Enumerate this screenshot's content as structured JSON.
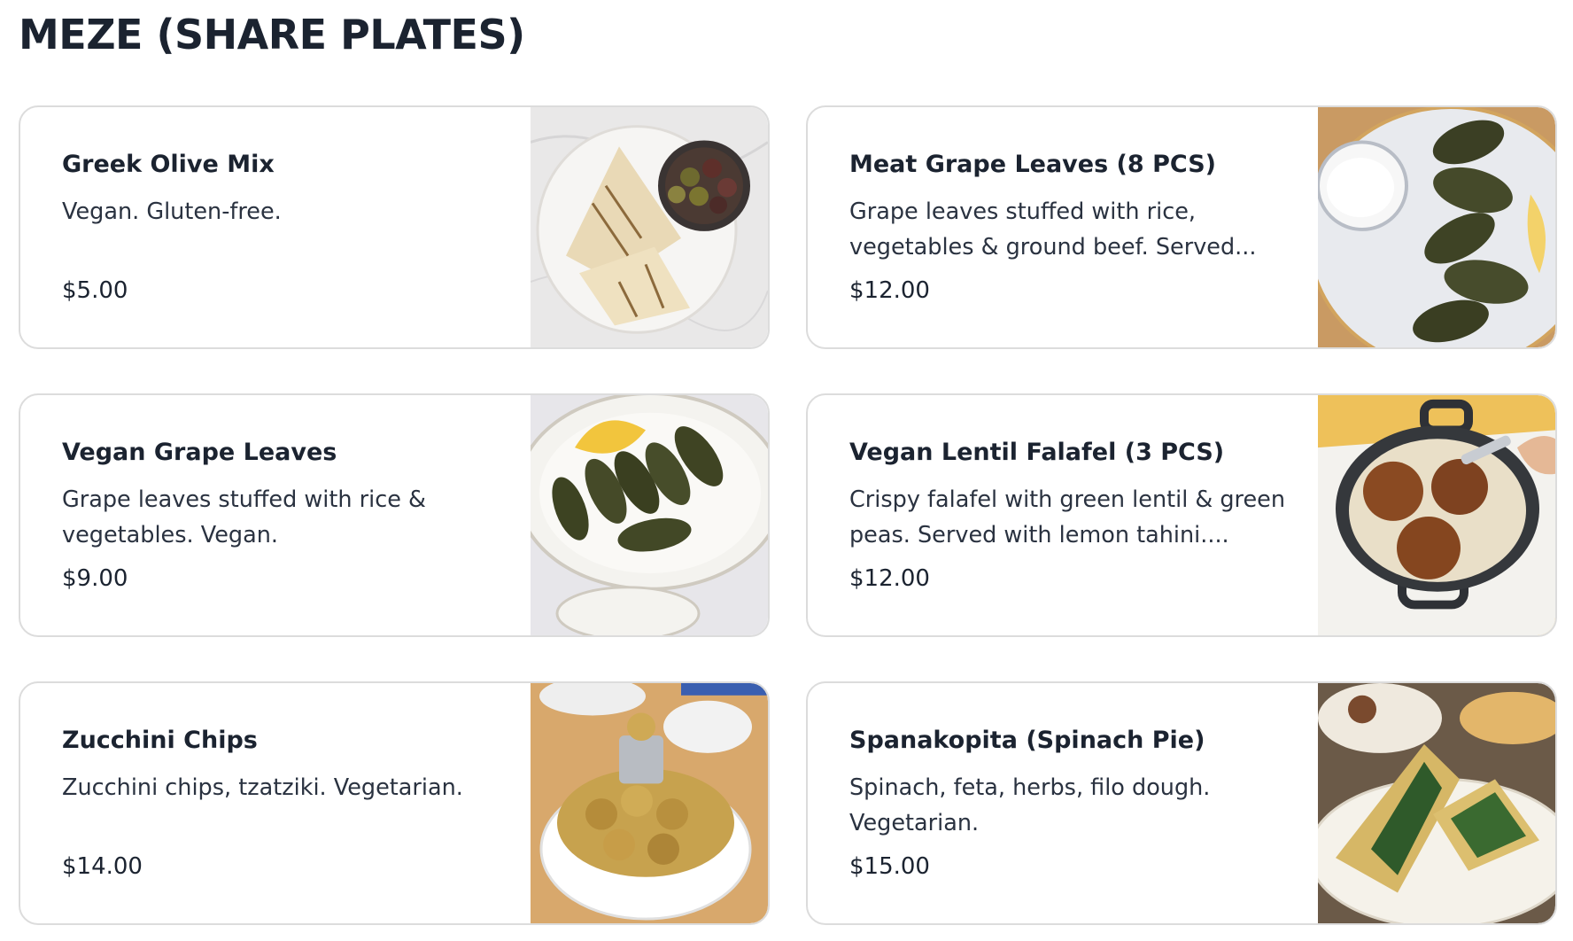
{
  "section": {
    "title": "MEZE (SHARE PLATES)"
  },
  "items": [
    {
      "name": "Greek Olive Mix",
      "description": "Vegan. Gluten-free.",
      "price": "$5.00",
      "image_icon": "olives-pita-photo-icon"
    },
    {
      "name": "Meat Grape Leaves (8 PCS)",
      "description": "Grape leaves stuffed with rice, vegetables & ground beef. Served...",
      "price": "$12.00",
      "image_icon": "grape-leaves-yogurt-photo-icon"
    },
    {
      "name": "Vegan Grape Leaves",
      "description": "Grape leaves stuffed with rice & vegetables. Vegan.",
      "price": "$9.00",
      "image_icon": "vegan-grape-leaves-photo-icon"
    },
    {
      "name": "Vegan Lentil Falafel (3 PCS)",
      "description": "Crispy falafel with green lentil & green peas. Served with lemon tahini....",
      "price": "$12.00",
      "image_icon": "falafel-skillet-photo-icon"
    },
    {
      "name": "Zucchini Chips",
      "description": "Zucchini chips, tzatziki. Vegetarian.",
      "price": "$14.00",
      "image_icon": "zucchini-chips-photo-icon"
    },
    {
      "name": "Spanakopita (Spinach Pie)",
      "description": "Spinach, feta, herbs, filo dough. Vegetarian.",
      "price": "$15.00",
      "image_icon": "spanakopita-photo-icon"
    }
  ]
}
